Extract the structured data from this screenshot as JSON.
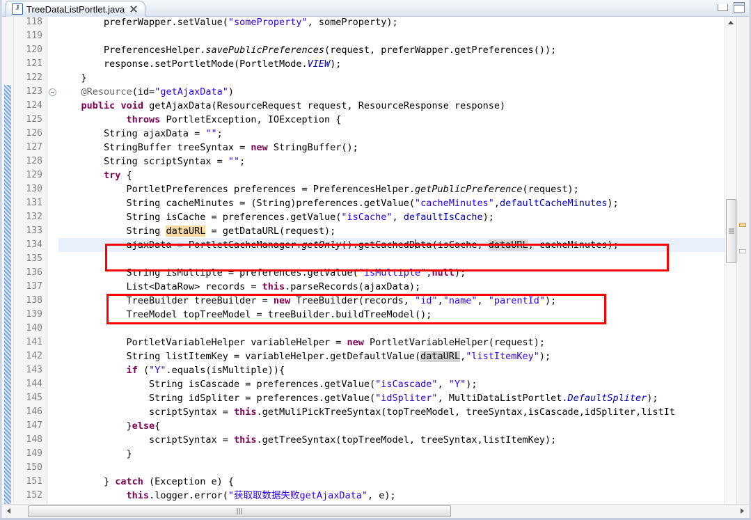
{
  "window": {
    "minimize_label": "Minimize",
    "maximize_label": "Maximize"
  },
  "tab": {
    "title": "TreeDataListPortlet.java",
    "icon": "java-file-icon",
    "close_label": "Close"
  },
  "editor": {
    "first_line": 118,
    "current_line": 134,
    "lines": [
      {
        "num": "118",
        "html": "        preferWapper.setValue(<span class=\"str\">\"someProperty\"</span>, someProperty);"
      },
      {
        "num": "119",
        "html": ""
      },
      {
        "num": "120",
        "html": "        PreferencesHelper.<span class=\"mth\">savePublicPreferences</span>(request, preferWapper.getPreferences());"
      },
      {
        "num": "121",
        "html": "        response.setPortletMode(PortletMode.<span class=\"stat\">VIEW</span>);"
      },
      {
        "num": "122",
        "html": "    }"
      },
      {
        "num": "123",
        "fold": true,
        "html": "    <span class=\"ann\">@Resource</span>(id=<span class=\"str\">\"getAjaxData\"</span>)"
      },
      {
        "num": "124",
        "html": "    <span class=\"kw\">public</span> <span class=\"kw\">void</span> getAjaxData(ResourceRequest request, ResourceResponse response)"
      },
      {
        "num": "125",
        "html": "            <span class=\"kw\">throws</span> PortletException, IOException {"
      },
      {
        "num": "126",
        "html": "        String ajaxData = <span class=\"str\">\"\"</span>;"
      },
      {
        "num": "127",
        "html": "        StringBuffer treeSyntax = <span class=\"kw\">new</span> StringBuffer();"
      },
      {
        "num": "128",
        "html": "        String scriptSyntax = <span class=\"str\">\"\"</span>;"
      },
      {
        "num": "129",
        "html": "        <span class=\"kw\">try</span> {"
      },
      {
        "num": "130",
        "html": "            PortletPreferences preferences = PreferencesHelper.<span class=\"mth\">getPublicPreference</span>(request);"
      },
      {
        "num": "131",
        "html": "            String cacheMinutes = (String)preferences.getValue(<span class=\"str\">\"cacheMinutes\"</span>,<span class=\"fld\">defaultCacheMinutes</span>);"
      },
      {
        "num": "132",
        "html": "            String isCache = preferences.getValue(<span class=\"str\">\"isCache\"</span>, <span class=\"fld\">defaultIsCache</span>);"
      },
      {
        "num": "133",
        "html": "            String <span class=\"occ-write\">dataURL</span> = getDataURL(request);"
      },
      {
        "num": "134",
        "html": "            ajaxData = PortletCacheManager.<span class=\"mth\">getOnly</span>().getCachedD<span class=\"caret\"></span>ata(isCache, <span class=\"occ-read\">dataURL</span>, cacheMinutes);"
      },
      {
        "num": "135",
        "html": ""
      },
      {
        "num": "136",
        "html": "            String isMultiple = preferences.getValue(<span class=\"str\">\"isMultiple\"</span>,<span class=\"kw\">null</span>);"
      },
      {
        "num": "137",
        "html": "            List&lt;DataRow&gt; records = <span class=\"kw\">this</span>.parseRecords(ajaxData);"
      },
      {
        "num": "138",
        "html": "            TreeBuilder treeBuilder = <span class=\"kw\">new</span> TreeBuilder(records, <span class=\"str\">\"id\"</span>,<span class=\"str\">\"name\"</span>, <span class=\"str\">\"parentId\"</span>);"
      },
      {
        "num": "139",
        "html": "            TreeModel topTreeModel = treeBuilder.buildTreeModel();"
      },
      {
        "num": "140",
        "html": ""
      },
      {
        "num": "141",
        "html": "            PortletVariableHelper variableHelper = <span class=\"kw\">new</span> PortletVariableHelper(request);"
      },
      {
        "num": "142",
        "html": "            String listItemKey = variableHelper.getDefaultValue(<span class=\"occ-read\">dataURL</span>,<span class=\"str\">\"listItemKey\"</span>);"
      },
      {
        "num": "143",
        "html": "            <span class=\"kw\">if</span> (<span class=\"str\">\"Y\"</span>.equals(isMultiple)){"
      },
      {
        "num": "144",
        "html": "                String isCascade = preferences.getValue(<span class=\"str\">\"isCascade\"</span>, <span class=\"str\">\"Y\"</span>);"
      },
      {
        "num": "145",
        "html": "                String idSpliter = preferences.getValue(<span class=\"str\">\"idSpliter\"</span>, MultiDataListPortlet.<span class=\"stat\">DefaultSpliter</span>);"
      },
      {
        "num": "146",
        "html": "                scriptSyntax = <span class=\"kw\">this</span>.getMuliPickTreeSyntax(topTreeModel, treeSyntax,isCascade,idSpliter,listIt"
      },
      {
        "num": "147",
        "html": "            }<span class=\"kw\">else</span>{"
      },
      {
        "num": "148",
        "html": "                scriptSyntax = <span class=\"kw\">this</span>.getTreeSyntax(topTreeModel, treeSyntax,listItemKey);"
      },
      {
        "num": "149",
        "html": "            }"
      },
      {
        "num": "150",
        "html": ""
      },
      {
        "num": "151",
        "html": "        } <span class=\"kw\">catch</span> (Exception e) {"
      },
      {
        "num": "152",
        "html": "            <span class=\"kw\">this</span>.logger.error(<span class=\"str\">\"获取取数据失败getAjaxData\"</span>, e);"
      }
    ],
    "annotations": [
      {
        "name": "red-highlight-box-1",
        "lines": "133-134",
        "color": "#ff0000"
      },
      {
        "name": "red-highlight-box-2",
        "lines": "137-138",
        "color": "#ff0000"
      }
    ],
    "occurrence_variable": "dataURL"
  },
  "scrollbars": {
    "vertical_up_arrow": "scroll-up",
    "horizontal_left_arrow": "scroll-left",
    "horizontal_right_arrow": "scroll-right"
  }
}
